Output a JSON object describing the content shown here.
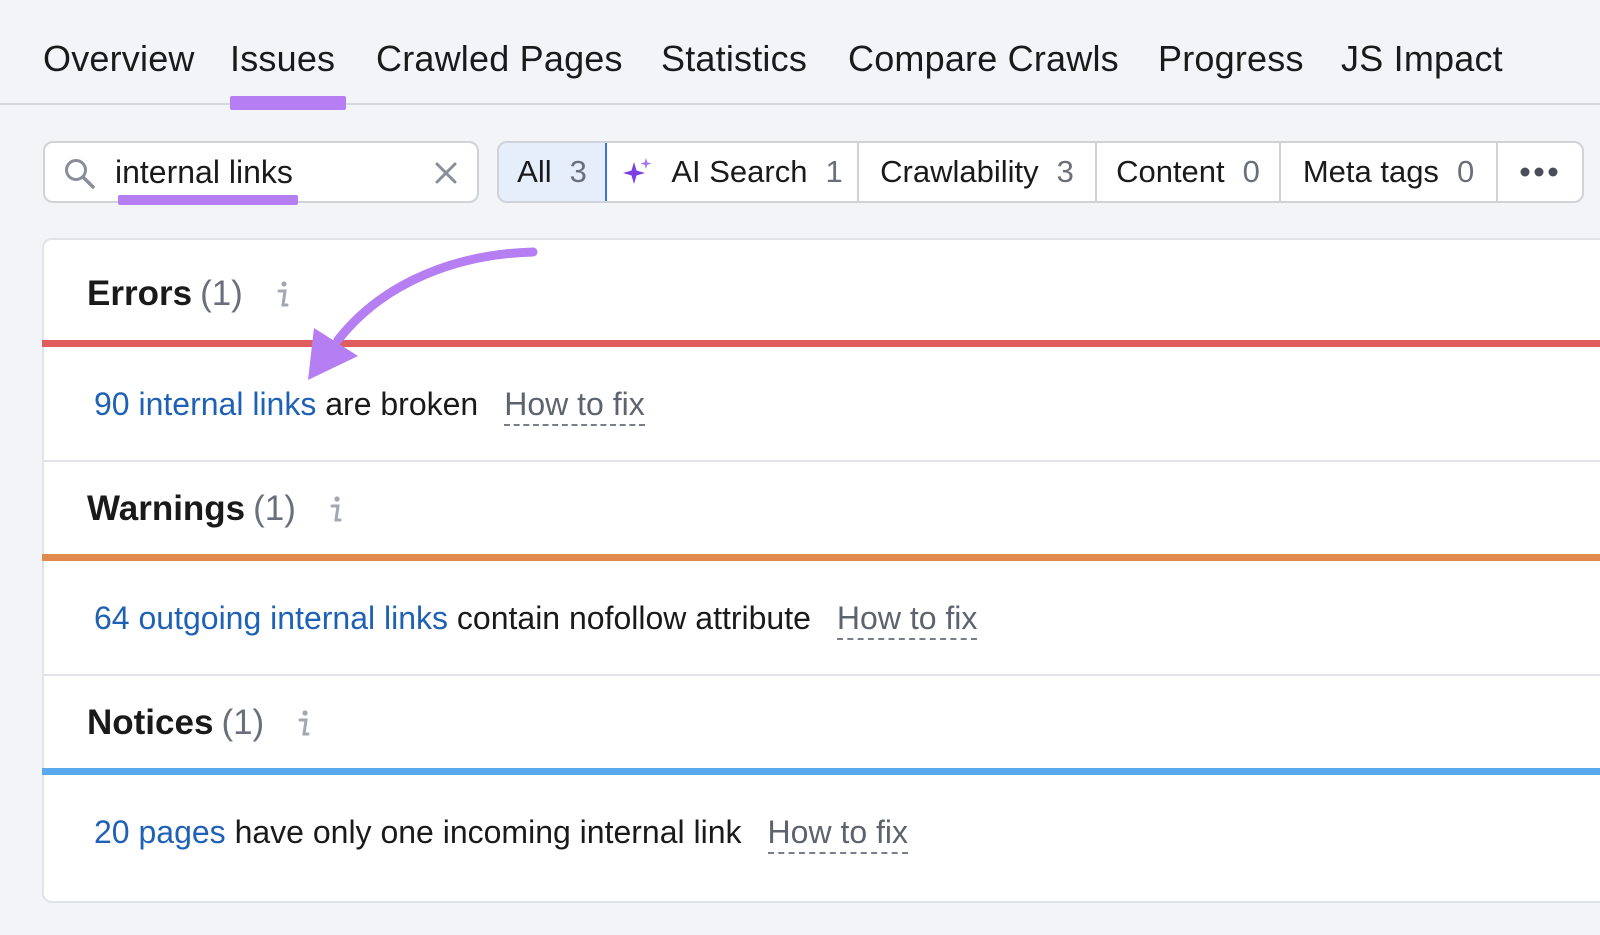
{
  "tabs": [
    {
      "label": "Overview"
    },
    {
      "label": "Issues"
    },
    {
      "label": "Crawled Pages"
    },
    {
      "label": "Statistics"
    },
    {
      "label": "Compare Crawls"
    },
    {
      "label": "Progress"
    },
    {
      "label": "JS Impact"
    }
  ],
  "active_tab": "Issues",
  "search": {
    "value": "internal links",
    "icon": "search-icon",
    "clear_icon": "close-icon"
  },
  "filters": [
    {
      "label": "All",
      "count": "3",
      "active": true
    },
    {
      "label": "AI Search",
      "count": "1",
      "icon": "sparkle-icon"
    },
    {
      "label": "Crawlability",
      "count": "3"
    },
    {
      "label": "Content",
      "count": "0"
    },
    {
      "label": "Meta tags",
      "count": "0"
    }
  ],
  "more_icon": "more-dots-icon",
  "sections": [
    {
      "title": "Errors",
      "count": "(1)",
      "color": "#e05d5d",
      "issue": {
        "link": "90 internal links",
        "text": " are broken",
        "fix": "How to fix"
      }
    },
    {
      "title": "Warnings",
      "count": "(1)",
      "color": "#e08a4e",
      "issue": {
        "link": "64 outgoing internal links",
        "text": " contain nofollow attribute",
        "fix": "How to fix"
      }
    },
    {
      "title": "Notices",
      "count": "(1)",
      "color": "#5aa9ec",
      "issue": {
        "link": "20 pages",
        "text": " have only one incoming internal link",
        "fix": "How to fix"
      }
    }
  ],
  "accent_color": "#b57ef2",
  "link_color": "#1f62b5"
}
